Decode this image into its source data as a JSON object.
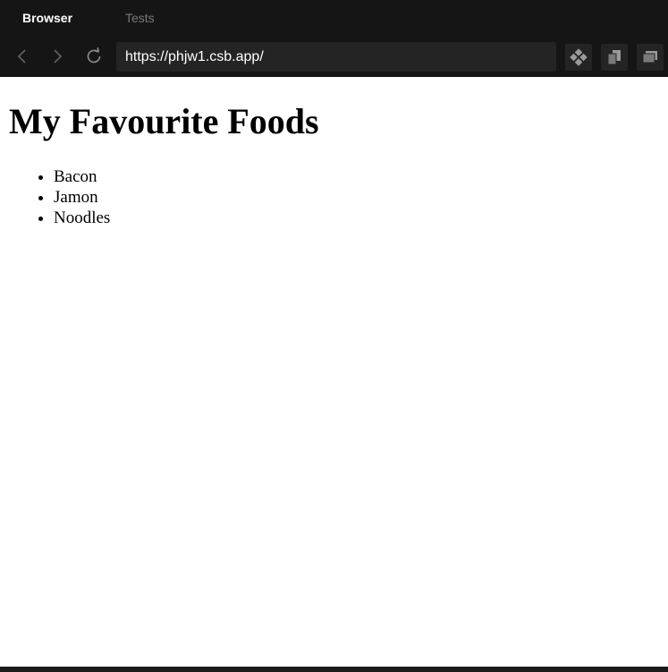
{
  "tabs": [
    {
      "label": "Browser",
      "active": true
    },
    {
      "label": "Tests",
      "active": false
    }
  ],
  "toolbar": {
    "url": "https://phjw1.csb.app/",
    "icons": {
      "back": "chevron-left-icon",
      "forward": "chevron-right-icon",
      "reload": "reload-icon",
      "tool1": "codesandbox-icon",
      "tool2": "copy-icon",
      "tool3": "new-window-icon"
    }
  },
  "page": {
    "heading": "My Favourite Foods",
    "items": [
      "Bacon",
      "Jamon",
      "Noodles"
    ]
  },
  "colors": {
    "chrome_bg": "#151515",
    "field_bg": "#242424",
    "active_tab": "#ffffff",
    "inactive_tab": "#7a7a7a",
    "icon_gray": "#8a8a8a",
    "page_bg": "#ffffff"
  }
}
